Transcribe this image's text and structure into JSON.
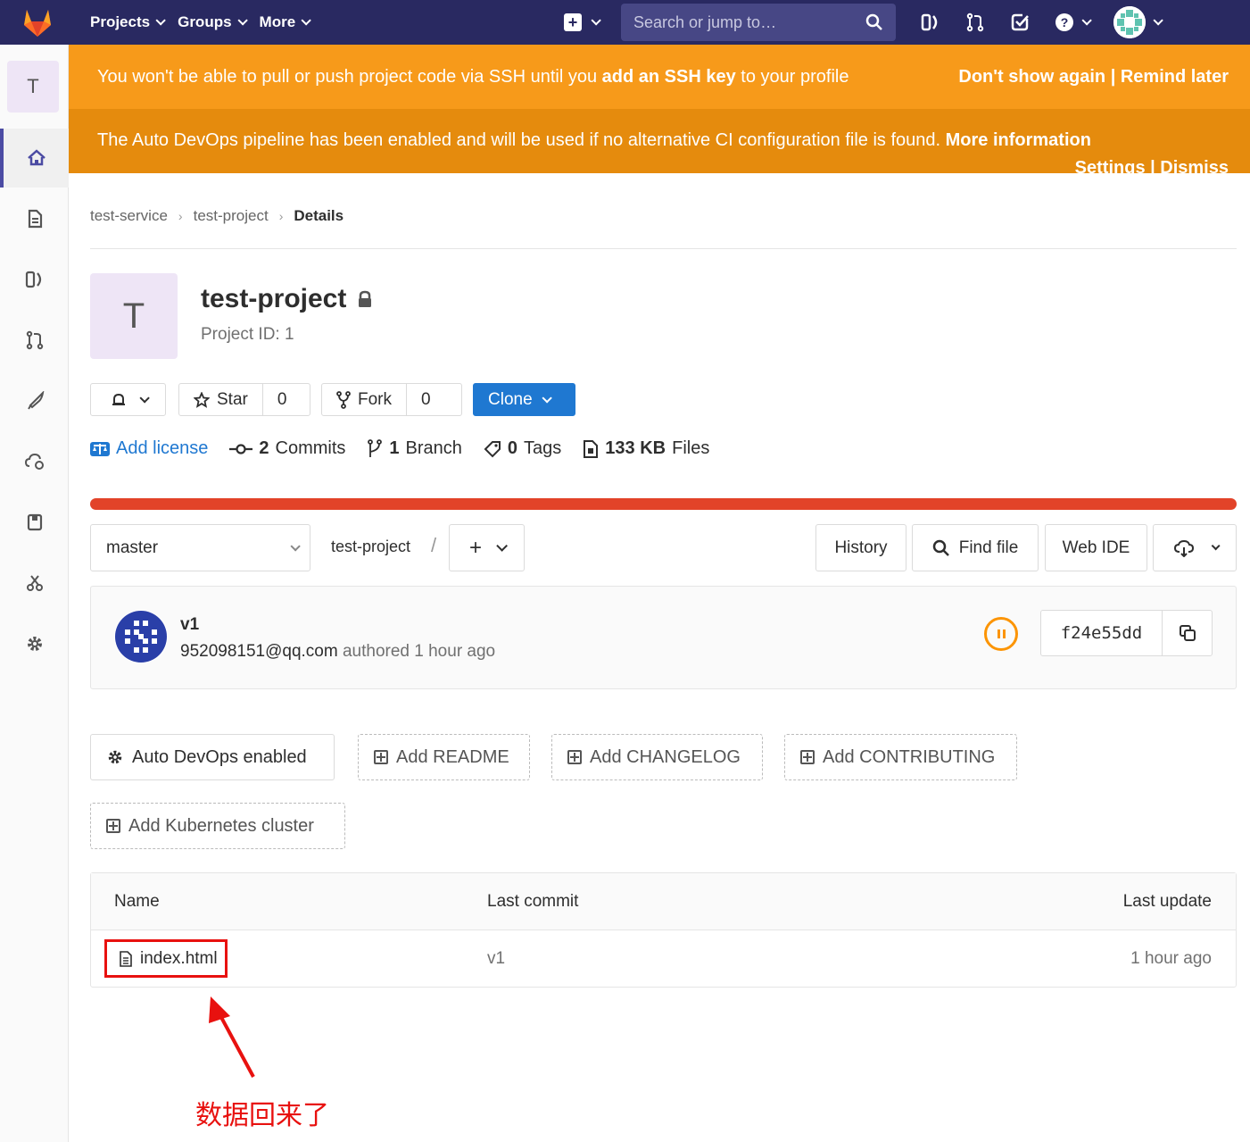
{
  "nav": {
    "projects": "Projects",
    "groups": "Groups",
    "more": "More",
    "search_placeholder": "Search or jump to…"
  },
  "sidebar": {
    "project_letter": "T"
  },
  "banners": {
    "ssh_prefix": "You won't be able to pull or push project code via SSH until you ",
    "ssh_bold": "add an SSH key",
    "ssh_suffix": " to your profile",
    "ssh_actions": "Don't show again | Remind later",
    "devops_text": "The Auto DevOps pipeline has been enabled and will be used if no alternative CI configuration file is found. ",
    "devops_more": "More information",
    "devops_actions": "Settings | Dismiss"
  },
  "breadcrumb": [
    "test-service",
    "test-project",
    "Details"
  ],
  "project": {
    "letter": "T",
    "name": "test-project",
    "id_label": "Project ID: 1"
  },
  "actions": {
    "star_label": "Star",
    "star_count": "0",
    "fork_label": "Fork",
    "fork_count": "0",
    "clone_label": "Clone"
  },
  "stats": {
    "license": "Add license",
    "commits_count": "2",
    "commits_label": "Commits",
    "branch_count": "1",
    "branch_label": "Branch",
    "tags_count": "0",
    "tags_label": "Tags",
    "files_size": "133 KB",
    "files_label": "Files"
  },
  "tree": {
    "branch": "master",
    "path": "test-project",
    "path_sep": "/",
    "history": "History",
    "find_file": "Find file",
    "web_ide": "Web IDE"
  },
  "commit": {
    "title": "v1",
    "author": "952098151@qq.com",
    "authored": "authored 1 hour ago",
    "sha": "f24e55dd"
  },
  "quick_actions": {
    "auto_devops": "Auto DevOps enabled",
    "readme": "Add README",
    "changelog": "Add CHANGELOG",
    "contributing": "Add CONTRIBUTING",
    "kubernetes": "Add Kubernetes cluster"
  },
  "files": {
    "headers": [
      "Name",
      "Last commit",
      "Last update"
    ],
    "rows": [
      {
        "name": "index.html",
        "last_commit": "v1",
        "last_update": "1 hour ago"
      }
    ]
  },
  "annotation": "数据回来了",
  "colors": {
    "nav_bg": "#292961",
    "banner_orange": "#f79a1a",
    "banner_dark_orange": "#e58b0d",
    "clone_blue": "#1f78d1",
    "progress_red": "#e24329",
    "annotation_red": "#e8110f"
  }
}
